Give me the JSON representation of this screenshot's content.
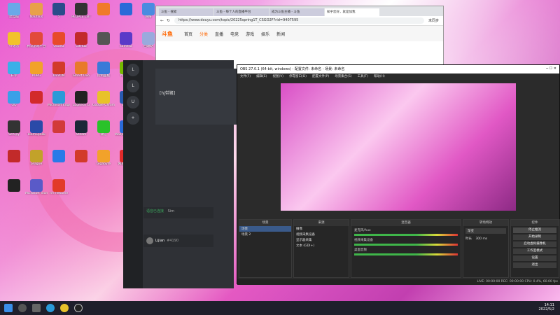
{
  "desktop_icons": [
    {
      "label": "此电脑",
      "color": "#6aa8e8"
    },
    {
      "label": "Nautilus",
      "color": "#e8a04a"
    },
    {
      "label": "5",
      "color": "#2a4c8a"
    },
    {
      "label": "PEOPLE CBT",
      "color": "#333"
    },
    {
      "label": "",
      "color": "#f07a2a"
    },
    {
      "label": "",
      "color": "#2a6ad8"
    },
    {
      "label": "网络",
      "color": "#4a8be0"
    },
    {
      "label": "YY语音",
      "color": "#f2c22a"
    },
    {
      "label": "腾讯游戏平台",
      "color": "#e24a3a"
    },
    {
      "label": "Quartz",
      "color": "#e84a2a"
    },
    {
      "label": "GitHub",
      "color": "#c22a2a"
    },
    {
      "label": "",
      "color": "#555"
    },
    {
      "label": "kaiheila",
      "color": "#5a3ac8"
    },
    {
      "label": "回收站",
      "color": "#9ad"
    },
    {
      "label": "轩宇",
      "color": "#3ab0e8"
    },
    {
      "label": "PUBG",
      "color": "#f2a22a"
    },
    {
      "label": "DEVON",
      "color": "#d23a2a"
    },
    {
      "label": "Smart Duo",
      "color": "#e87a2a"
    },
    {
      "label": "控制面板",
      "color": "#3a7ad8"
    },
    {
      "label": "NVIDIA",
      "color": "#76b900"
    },
    {
      "label": "Steam",
      "color": "#1b2838"
    },
    {
      "label": "QQ",
      "color": "#3aa0e8"
    },
    {
      "label": "",
      "color": "#d22a2a"
    },
    {
      "label": "Microsoft Edge",
      "color": "#2a9ad8"
    },
    {
      "label": "Logitech G",
      "color": "#222"
    },
    {
      "label": "Google Chrome",
      "color": "#e8c22a"
    },
    {
      "label": "Word",
      "color": "#2a5ab0"
    },
    {
      "label": "Google Chrome",
      "color": "#4a8ae8"
    },
    {
      "label": "ScrCpy",
      "color": "#333"
    },
    {
      "label": "TeamSpeak",
      "color": "#2a4aa8"
    },
    {
      "label": "",
      "color": "#d23a3a"
    },
    {
      "label": "Steam",
      "color": "#1b2838"
    },
    {
      "label": "微信",
      "color": "#2ac22a"
    },
    {
      "label": "Wallpaper Engine",
      "color": "#2a6ad8"
    },
    {
      "label": "PowerPoint",
      "color": "#d24a2a"
    },
    {
      "label": "",
      "color": "#c22a2a"
    },
    {
      "label": "League",
      "color": "#c2a22a"
    },
    {
      "label": "",
      "color": "#2a7ae8"
    },
    {
      "label": "",
      "color": "#d23a2a"
    },
    {
      "label": "Gigabyte",
      "color": "#f2a22a"
    },
    {
      "label": "网易云音乐",
      "color": "#e22a2a"
    },
    {
      "label": "Sogou",
      "color": "#f27a2a"
    },
    {
      "label": "",
      "color": "#222"
    },
    {
      "label": "Microsoft Teams",
      "color": "#5a5ac8"
    },
    {
      "label": "Fre Resume",
      "color": "#e23a2a"
    }
  ],
  "browser": {
    "tabs": [
      "斗鱼 - 搜索",
      "斗鱼 - 每个人的直播平台",
      "成为斗鱼主播 - 斗鱼",
      "知乎您好，就是加我"
    ],
    "url": "https://www.douyu.com/topic/20225spring1T_CSGO2F?rid=9407595",
    "account": "未同步",
    "site_logo": "斗鱼",
    "nav": [
      "首页",
      "分类",
      "直播",
      "电竞",
      "游戏",
      "娱乐",
      "新闻"
    ]
  },
  "discord": {
    "servers": [
      "L",
      "L",
      "U",
      "+"
    ],
    "channel_preview": "[hj带猪]",
    "voice_status": "语音已连接",
    "voice_channel": "Sim",
    "user_name": "Lijian",
    "user_tag": "#4190"
  },
  "obs": {
    "title": "OBS 27.0.1 (64-bit, windows) - 配置文件: 未命名 - 场景: 未命名",
    "menu": [
      "文件(F)",
      "编辑(E)",
      "视图(V)",
      "停靠窗口(D)",
      "配置文件(P)",
      "场景集合(S)",
      "工具(T)",
      "帮助(H)"
    ],
    "panels": {
      "scenes": {
        "title": "场景",
        "items": [
          "场景",
          "场景 2"
        ]
      },
      "sources": {
        "title": "来源",
        "items": [
          "摄像",
          "视频采集设备",
          "显示器采集",
          "文本 (GDI+)"
        ]
      },
      "mixer": {
        "title": "混音器",
        "rows": [
          "麦克风/Aux",
          "视频采集设备",
          "桌面音频"
        ]
      },
      "transitions": {
        "title": "转场特效",
        "type": "渐变",
        "duration_label": "时长",
        "duration": "300 ms"
      },
      "controls": {
        "title": "控件",
        "buttons": [
          "停止推流",
          "开始录制",
          "启动虚拟摄像机",
          "工作室模式",
          "设置",
          "退出"
        ]
      }
    },
    "status": "LIVE: 00:00:00   REC: 00:00:00   CPU: 0.4%, 60.00 fps"
  },
  "taskbar": {
    "time": "14:11",
    "date": "2022/5/2"
  }
}
